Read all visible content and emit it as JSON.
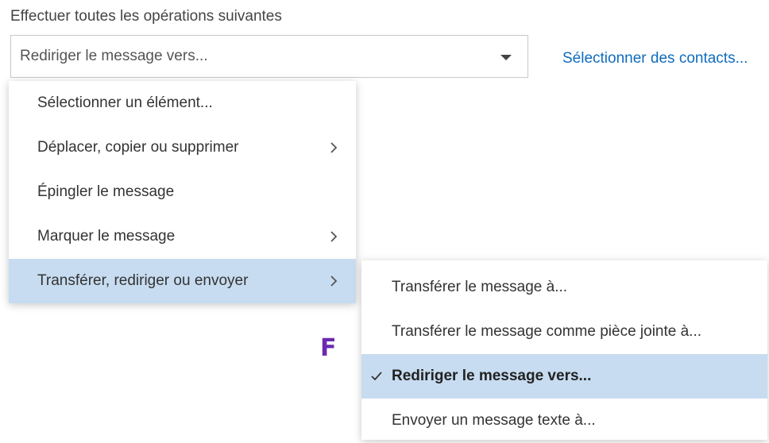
{
  "rule": {
    "heading": "Effectuer toutes les opérations suivantes",
    "select_value": "Rediriger le message vers...",
    "select_icon": "dropdown-arrow-icon",
    "contacts_link": "Sélectionner des contacts..."
  },
  "menu": {
    "items": [
      {
        "label": "Sélectionner un élément...",
        "has_submenu": false
      },
      {
        "label": "Déplacer, copier ou supprimer",
        "has_submenu": true,
        "icon": "chevron-right-icon"
      },
      {
        "label": "Épingler le message",
        "has_submenu": false
      },
      {
        "label": "Marquer le message",
        "has_submenu": true,
        "icon": "chevron-right-icon"
      },
      {
        "label": "Transférer, rediriger ou envoyer",
        "has_submenu": true,
        "icon": "chevron-right-icon",
        "active": true
      }
    ]
  },
  "submenu": {
    "items": [
      {
        "label": "Transférer le message à..."
      },
      {
        "label": "Transférer le message comme pièce jointe à..."
      },
      {
        "label": "Rediriger le message vers...",
        "selected": true,
        "icon": "checkmark-icon"
      },
      {
        "label": "Envoyer un message texte à..."
      }
    ]
  },
  "watermark": {
    "letter": "F"
  },
  "colors": {
    "link": "#0f6cbd",
    "highlight": "#c7dcf0",
    "border": "#c8c8c8",
    "watermark": "#6a2bb0"
  }
}
